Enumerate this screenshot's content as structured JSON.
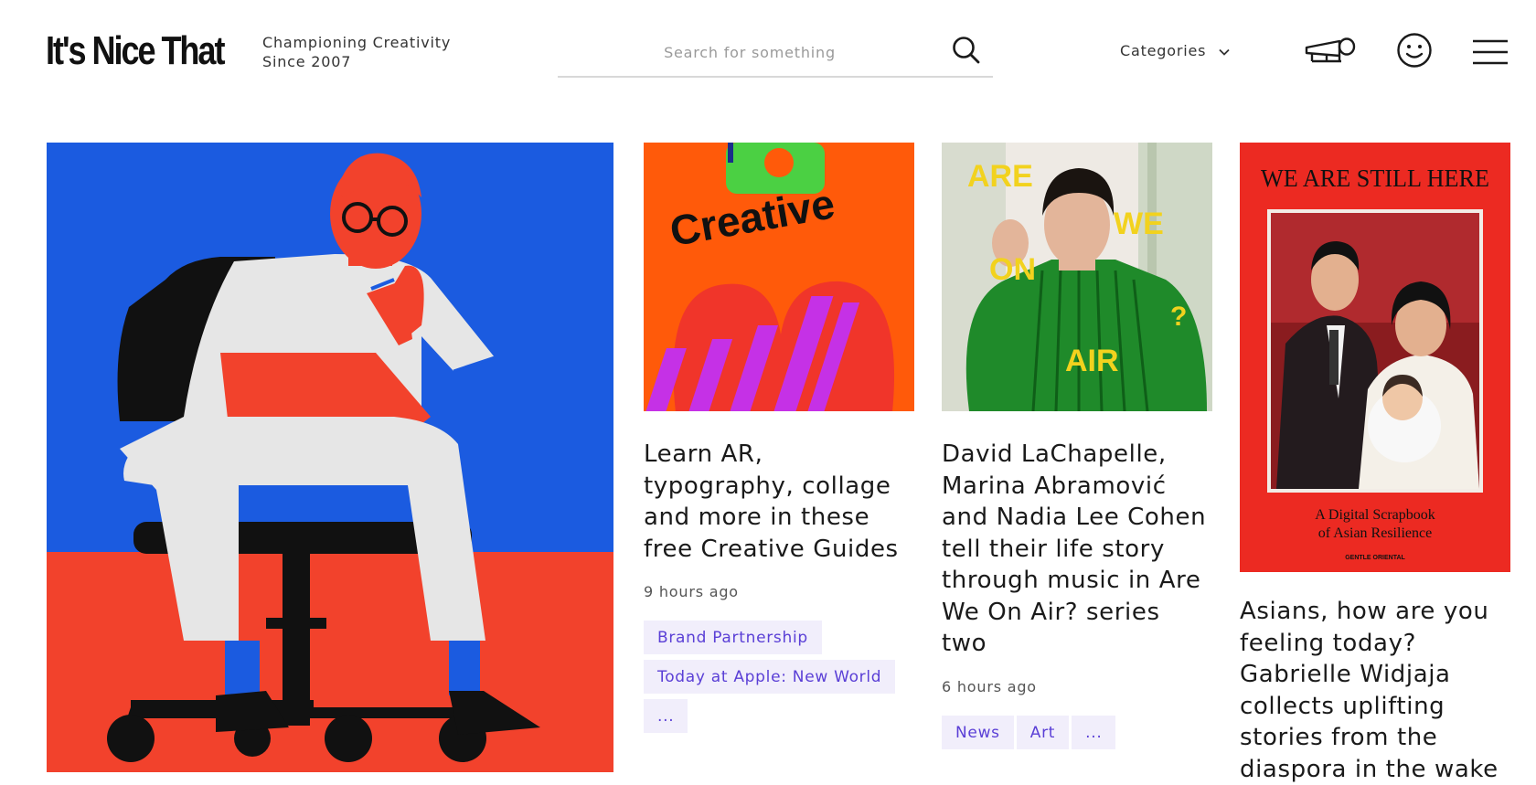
{
  "brand": {
    "logo": "It's Nice That",
    "tagline_line1": "Championing Creativity",
    "tagline_line2": "Since 2007"
  },
  "search": {
    "placeholder": "Search for something",
    "icon": "search-icon"
  },
  "nav": {
    "categories_label": "Categories",
    "icons": [
      "megaphone-icon",
      "smiley-icon",
      "hamburger-menu-icon"
    ]
  },
  "featured": {
    "image": "illustration of a person in glasses sitting on an office chair",
    "colors": {
      "sky": "#1b5be0",
      "floor": "#f2422c",
      "clothes": "#e6e6e6",
      "skin": "#f2422c",
      "chair": "#111111"
    }
  },
  "articles": [
    {
      "title": "Learn AR, typography, collage and more in these free Creative Guides",
      "time": "9 hours ago",
      "image_text": "Creative",
      "tags": [
        "Brand Partnership",
        "Today at Apple: New World",
        "..."
      ]
    },
    {
      "title": "David LaChapelle, Marina Abramović and Nadia Lee Cohen tell their life story through music in Are We On Air? series two",
      "time": "6 hours ago",
      "image_text": {
        "w1": "ARE",
        "w2": "WE",
        "w3": "ON",
        "w4": "?",
        "w5": "AIR"
      },
      "tags": [
        "News",
        "Art",
        "..."
      ]
    },
    {
      "title": "Asians, how are you feeling today? Gabrielle Widjaja collects uplifting stories from the diaspora in the wake",
      "image_text": {
        "heading": "WE ARE STILL HERE",
        "subtitle1": "A Digital Scrapbook",
        "subtitle2": "of Asian Resilience",
        "publisher": "GENTLE ORIENTAL"
      }
    }
  ],
  "colors": {
    "tag_bg": "#f1eefb",
    "tag_text": "#5a3fd6",
    "accent_orange": "#ff5a0a",
    "accent_red": "#ec2a22",
    "accent_yellow": "#f2d21e"
  }
}
